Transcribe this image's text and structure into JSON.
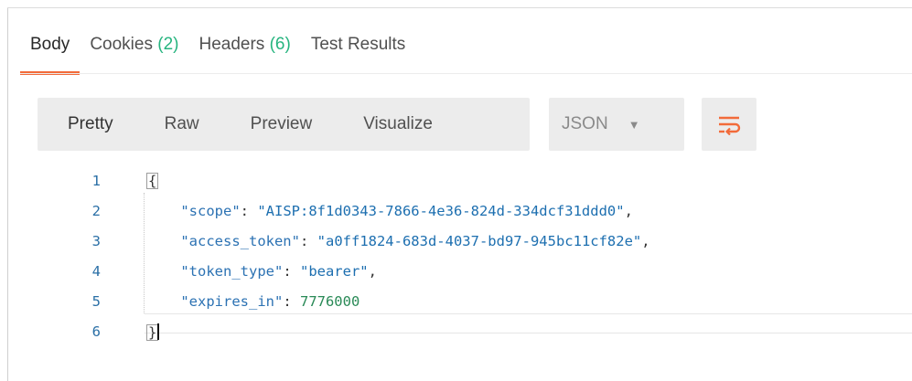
{
  "tabs": [
    {
      "label": "Body",
      "count": ""
    },
    {
      "label": "Cookies",
      "count": "(2)"
    },
    {
      "label": "Headers",
      "count": "(6)"
    },
    {
      "label": "Test Results",
      "count": ""
    }
  ],
  "active_tab": "Body",
  "format_buttons": [
    "Pretty",
    "Raw",
    "Preview",
    "Visualize"
  ],
  "selected_format": "Pretty",
  "language_select": {
    "value": "JSON",
    "icon": "caret-down-icon"
  },
  "wrap_button": {
    "icon": "wrap-lines-icon",
    "color": "#f26b3a"
  },
  "accent_color": "#f26b3a",
  "count_color": "#26b47f",
  "editor": {
    "line_numbers": [
      "1",
      "2",
      "3",
      "4",
      "5",
      "6"
    ],
    "open_brace": "{",
    "close_brace": "}",
    "entries": [
      {
        "key": "\"scope\"",
        "value": "\"AISP:8f1d0343-7866-4e36-824d-334dcf31ddd0\"",
        "comma": ","
      },
      {
        "key": "\"access_token\"",
        "value": "\"a0ff1824-683d-4037-bd97-945bc11cf82e\"",
        "comma": ","
      },
      {
        "key": "\"token_type\"",
        "value": "\"bearer\"",
        "comma": ","
      },
      {
        "key": "\"expires_in\"",
        "value": "7776000",
        "comma": ""
      }
    ]
  }
}
